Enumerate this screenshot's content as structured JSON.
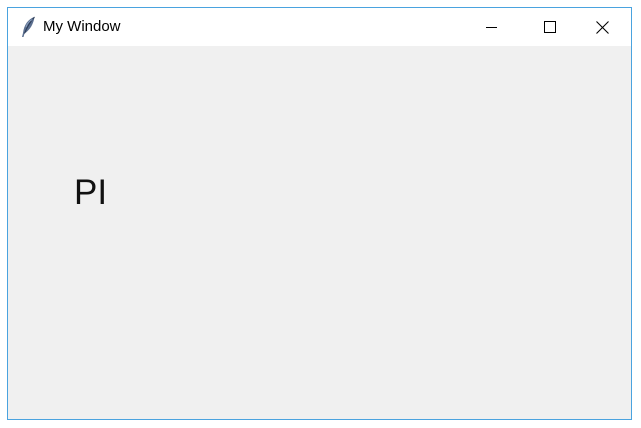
{
  "window": {
    "title": "My Window",
    "app_icon": "feather-icon",
    "border_color": "#4aa3df",
    "titlebar_bg": "#ffffff",
    "client_bg": "#f0f0f0"
  },
  "caption_buttons": {
    "minimize_icon": "minimize-icon",
    "maximize_icon": "maximize-icon",
    "close_icon": "close-icon"
  },
  "content": {
    "label": "PI"
  }
}
